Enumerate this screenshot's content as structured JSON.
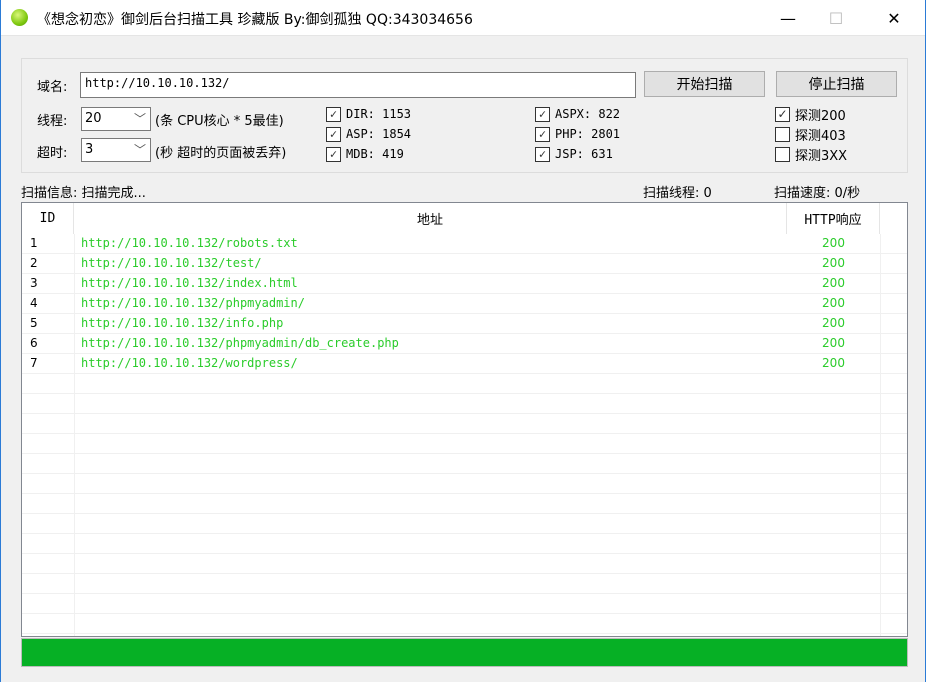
{
  "window": {
    "title": "《想念初恋》御剑后台扫描工具 珍藏版 By:御剑孤独 QQ:343034656",
    "minimize": "—",
    "maximize": "☐",
    "close": "✕"
  },
  "form": {
    "domain_label": "域名:",
    "domain_value": "http://10.10.10.132/",
    "start_button": "开始扫描",
    "stop_button": "停止扫描",
    "threads_label": "线程:",
    "threads_value": "20",
    "threads_hint": "(条 CPU核心 * 5最佳)",
    "timeout_label": "超时:",
    "timeout_value": "3",
    "timeout_hint": "(秒 超时的页面被丢弃)",
    "dicts": [
      {
        "label": "DIR: 1153",
        "checked": true
      },
      {
        "label": "ASP: 1854",
        "checked": true
      },
      {
        "label": "MDB: 419",
        "checked": true
      },
      {
        "label": "ASPX: 822",
        "checked": true
      },
      {
        "label": "PHP: 2801",
        "checked": true
      },
      {
        "label": "JSP: 631",
        "checked": true
      }
    ],
    "probes": [
      {
        "label": "探测200",
        "checked": true
      },
      {
        "label": "探测403",
        "checked": false
      },
      {
        "label": "探测3XX",
        "checked": false
      }
    ]
  },
  "status": {
    "info": "扫描信息: 扫描完成...",
    "threads": "扫描线程: 0",
    "speed": "扫描速度: 0/秒"
  },
  "table": {
    "headers": [
      "ID",
      "地址",
      "HTTP响应"
    ],
    "rows": [
      [
        "1",
        "http://10.10.10.132/robots.txt",
        "200"
      ],
      [
        "2",
        "http://10.10.10.132/test/",
        "200"
      ],
      [
        "3",
        "http://10.10.10.132/index.html",
        "200"
      ],
      [
        "4",
        "http://10.10.10.132/phpmyadmin/",
        "200"
      ],
      [
        "5",
        "http://10.10.10.132/info.php",
        "200"
      ],
      [
        "6",
        "http://10.10.10.132/phpmyadmin/db_create.php",
        "200"
      ],
      [
        "7",
        "http://10.10.10.132/wordpress/",
        "200"
      ]
    ]
  },
  "progress": {
    "percent": 100,
    "color": "#06b025"
  }
}
